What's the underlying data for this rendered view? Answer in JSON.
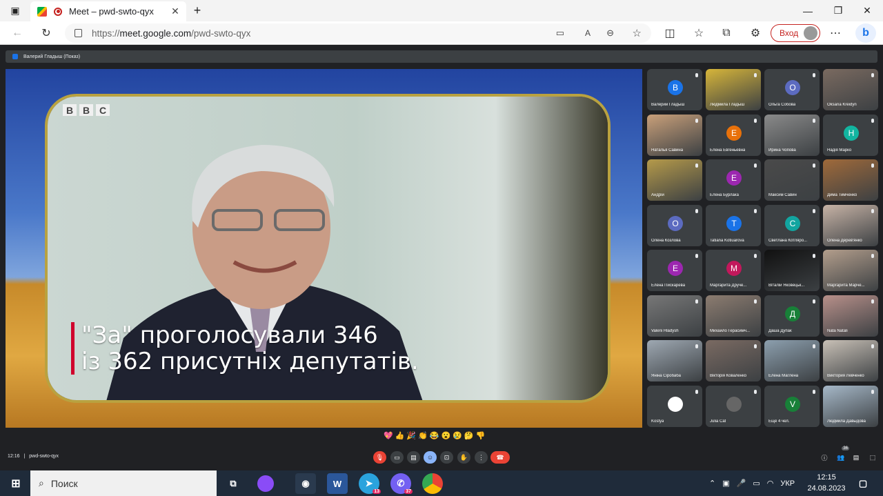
{
  "browser": {
    "tab_title": "Meet – pwd-swto-qyx",
    "url_proto": "https://",
    "url_host": "meet.google.com",
    "url_path": "/pwd-swto-qyx",
    "login_label": "Вход",
    "new_tab": "+"
  },
  "meet": {
    "presenter_label": "Валерий Гладыш (Показ)",
    "caption_line1": "\"За\" проголосували 346",
    "caption_line2": "із 362 присутніх депутатів.",
    "bbc": [
      "B",
      "B",
      "C"
    ],
    "time": "12:16",
    "meeting_code": "pwd-swto-qyx",
    "participant_count": "36",
    "participants": [
      {
        "name": "Валерий Гладыш",
        "initial": "В",
        "color": "#1a73e8"
      },
      {
        "name": "Людмила Гладыш",
        "initial": "",
        "color": "#d6b53a",
        "photo": true
      },
      {
        "name": "Ольга Собова",
        "initial": "О",
        "color": "#5c6bc0"
      },
      {
        "name": "Oksana Kreidyn",
        "initial": "",
        "color": "#7a6a60",
        "photo": true
      },
      {
        "name": "Наталья Савина",
        "initial": "",
        "color": "#c9a07a",
        "photo": true
      },
      {
        "name": "Елена Евгеньевна",
        "initial": "Е",
        "color": "#e8710a"
      },
      {
        "name": "Ирина Чопова",
        "initial": "",
        "color": "#8a8a8a",
        "photo": true
      },
      {
        "name": "Надія Марко",
        "initial": "Н",
        "color": "#12b5a0"
      },
      {
        "name": "Андрій",
        "initial": "",
        "color": "#b59a4a",
        "photo": true
      },
      {
        "name": "Елена Бурлака",
        "initial": "Е",
        "color": "#9c27b0"
      },
      {
        "name": "Максим Савин",
        "initial": "",
        "color": "#4a4a4a",
        "photo": true
      },
      {
        "name": "Дима Тимченко",
        "initial": "",
        "color": "#a06a3a",
        "photo": true
      },
      {
        "name": "Олена Козлова",
        "initial": "О",
        "color": "#5c6bc0"
      },
      {
        "name": "Tatiana Kotiuarova",
        "initial": "T",
        "color": "#1a73e8"
      },
      {
        "name": "Светлана Котляро...",
        "initial": "С",
        "color": "#12a5a0"
      },
      {
        "name": "Олена Дерев'янко",
        "initial": "",
        "color": "#c7b3a6",
        "photo": true
      },
      {
        "name": "Елена Пискарева",
        "initial": "Е",
        "color": "#9c27b0"
      },
      {
        "name": "Маргарита Дручe...",
        "initial": "М",
        "color": "#c2185b"
      },
      {
        "name": "Віталій Яковецьк...",
        "initial": "",
        "color": "#111111",
        "photo": true
      },
      {
        "name": "Маргарита Марче...",
        "initial": "",
        "color": "#b39e8c",
        "photo": true
      },
      {
        "name": "Valerii Hladysh",
        "initial": "",
        "color": "#777",
        "photo": true
      },
      {
        "name": "Михайло Герасимч...",
        "initial": "",
        "color": "#8c7c70",
        "photo": true
      },
      {
        "name": "Даша Дупак",
        "initial": "Д",
        "color": "#188038"
      },
      {
        "name": "Nata Natali",
        "initial": "",
        "color": "#b8908a",
        "photo": true
      },
      {
        "name": "Янiна Сiробаба",
        "initial": "",
        "color": "#9ea8b2",
        "photo": true
      },
      {
        "name": "Вікторія Коваленко",
        "initial": "",
        "color": "#7a6a62",
        "photo": true
      },
      {
        "name": "Елена Маглена",
        "initial": "",
        "color": "#8c9fae",
        "photo": true
      },
      {
        "name": "Виктория Левченко",
        "initial": "",
        "color": "#c8c0b6",
        "photo": true
      },
      {
        "name": "Kostya",
        "initial": "",
        "color": "#ffffff"
      },
      {
        "name": "Julia Cat",
        "initial": "",
        "color": "#666666"
      },
      {
        "name": "Ещё 4 чел.",
        "initial": "V",
        "color": "#188038"
      },
      {
        "name": "Людмила Давыдова",
        "initial": "",
        "color": "#a6b8c8",
        "photo": true
      }
    ],
    "emojis": [
      "💖",
      "👍",
      "🎉",
      "👏",
      "😂",
      "😮",
      "😢",
      "🤔",
      "👎"
    ]
  },
  "taskbar": {
    "search_placeholder": "Поиск",
    "telegram_badge": "13",
    "viber_badge": "37",
    "lang": "УКР",
    "time": "12:15",
    "date": "24.08.2023"
  },
  "colors": {
    "meet_bg": "#202124",
    "tile_bg": "#3c4043",
    "end_call": "#ea4335",
    "accent": "#8ab4f8"
  }
}
